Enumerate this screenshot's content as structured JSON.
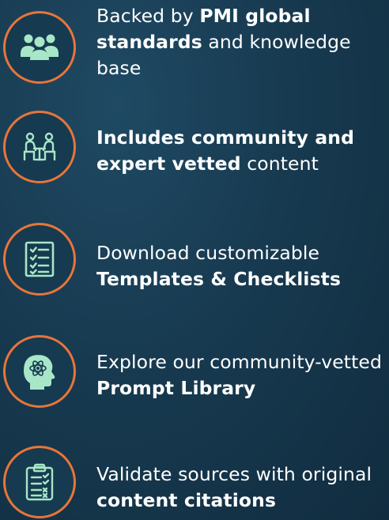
{
  "colors": {
    "accent_orange": "#e8753a",
    "icon_mint": "#a8e6c8",
    "background": "#173a50"
  },
  "features": [
    {
      "icon": "people-group-icon",
      "text_pre": "Backed by ",
      "text_bold": "PMI global standards",
      "text_post": " and knowledge base"
    },
    {
      "icon": "meeting-table-icon",
      "text_pre": "",
      "text_bold": "Includes community and expert vetted",
      "text_post": " content"
    },
    {
      "icon": "checklist-icon",
      "text_pre": "Download customizable ",
      "text_bold": "Templates & Checklists",
      "text_post": ""
    },
    {
      "icon": "head-atom-icon",
      "text_pre": "Explore our community-vetted ",
      "text_bold": "Prompt Library",
      "text_post": ""
    },
    {
      "icon": "clipboard-checklist-icon",
      "text_pre": "Validate sources with original ",
      "text_bold": "content citations",
      "text_post": ""
    }
  ]
}
